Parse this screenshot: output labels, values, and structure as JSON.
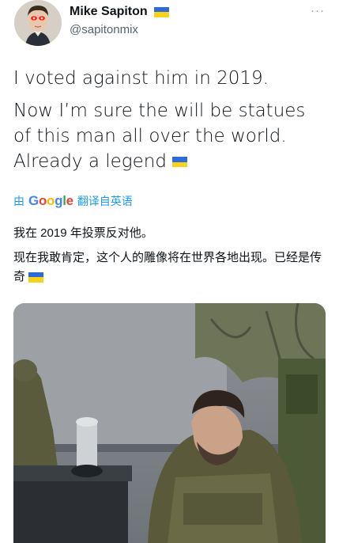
{
  "user": {
    "name": "Mike Sapiton",
    "handle": "@sapitonmix",
    "name_flag": "ukraine-flag-icon"
  },
  "more_label": "···",
  "tweet": {
    "line1": "I voted against him in 2019.",
    "line2": "Now I’m sure the will be statues of this man all over the world. Already a legend"
  },
  "translation": {
    "prefix": "由",
    "brand": [
      "G",
      "o",
      "o",
      "g",
      "l",
      "e"
    ],
    "suffix": "翻译自英语",
    "line1": "我在 2019 年投票反对他。",
    "line2": "现在我敢肯定，这个人的雕像将在世界各地出现。已经是传奇"
  },
  "colors": {
    "link": "#1d9bf0",
    "flag_blue": "#2f6bd4",
    "flag_yellow": "#f6d21c"
  }
}
